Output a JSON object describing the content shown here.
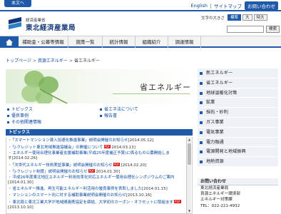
{
  "header": {
    "home_tab": "本文へ",
    "util_links": [
      "English",
      "サイトマップ",
      "お問い合わせ"
    ],
    "logo_sub": "経済産業省",
    "logo_main": "東北経済産業局",
    "font_size_label": "文字の大きさ",
    "font_sizes": [
      "標準",
      "大",
      "特大"
    ],
    "search_placeholder": "",
    "search_button": "検索"
  },
  "nav": {
    "items": [
      "補助金・公募等情報",
      "施策一覧",
      "統計情報",
      "組織紹介",
      "調達情報"
    ]
  },
  "breadcrumb": [
    "トップページ",
    "資源エネルギー",
    "省エネルギー"
  ],
  "hero": {
    "title": "省エネルギー"
  },
  "links": [
    "トピックス",
    "省エネ法について",
    "優良事例",
    "報告書",
    "その他関連情報"
  ],
  "topics": {
    "heading": "トピックス",
    "items": [
      {
        "text": "「スマートマンション導入加速化推進事業」説明会開催のお知らせ",
        "date": "[2014.05.12]",
        "pdf": false
      },
      {
        "text": "「J-クレジット東北地域推進協議会」の開催について",
        "date": "2014.03.13]",
        "pdf": true
      },
      {
        "text": "エネルギー使用合理化事業者支援補助事業(平成25年度補正予算)に係るもの公募開始しま",
        "date": "す[2014.02.26]",
        "pdf": false
      },
      {
        "text": "「次世代エネルギー技術実証事業」説明会開催のお知らせ",
        "date": "[2014.02.20]",
        "pdf": true
      },
      {
        "text": "「J-クレジット制度」説明会開催のお知らせ",
        "date": "2014.01.30]",
        "pdf": true
      },
      {
        "text": "平成26年度東北地区エネルギー利用効率化対応エネルギー使用合理化シンポジウムのご案内",
        "date": "[2014.01.30]",
        "pdf": false
      },
      {
        "text": "省エネルギー推進、再生可能エネルギー利活用の優良事例を表彰しました",
        "date": "[2014.01.15]",
        "pdf": false
      },
      {
        "text": "マンションのスマート化に対する補助事業説明会開催のお知らせ",
        "date": "[2013.10.16]",
        "pdf": false
      },
      {
        "text": "東北局と東北工業大学が地域間連携協定を締結、大学初のカーボン・オフセットに取組ます",
        "date": "[2013.10.10]",
        "pdf": true
      }
    ]
  },
  "sidebar": {
    "items": [
      "新エネルギー",
      "省エネルギー",
      "地球温暖化対策",
      "鉱業",
      "採石・砂利",
      "ガス事業",
      "電気事業",
      "電力融通",
      "電源開発と地域振興",
      "地熱資源"
    ],
    "inquiry": {
      "heading": "お問い合わせ",
      "lines": [
        "東北経済産業局",
        "資源エネルギー環境部",
        "エネルギー対策課",
        "TEL：022-221-4932"
      ]
    }
  },
  "colors": {
    "primary": "#1e5aa8",
    "sidebar_bg": "#eef1f6",
    "link": "#0a4aa6"
  }
}
